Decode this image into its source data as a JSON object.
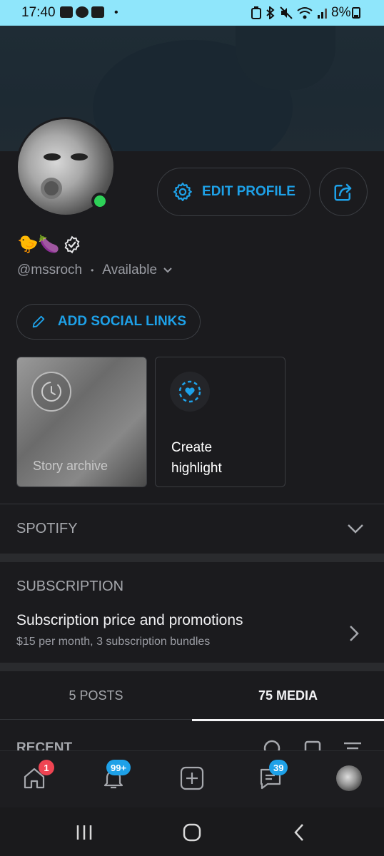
{
  "status_bar": {
    "time": "17:40",
    "battery": "8%",
    "background_color": "#8fe6fb"
  },
  "profile": {
    "emojis": "🐤🍆",
    "verified_icon": "verified-badge-icon",
    "handle": "@mssroch",
    "separator": "•",
    "availability": "Available",
    "edit_profile_label": "EDIT PROFILE",
    "add_social_links_label": "ADD SOCIAL LINKS",
    "online_color": "#2ed158"
  },
  "highlights": {
    "story_archive_label": "Story archive",
    "create_highlight_line1": "Create",
    "create_highlight_line2": "highlight"
  },
  "spotify": {
    "title": "SPOTIFY"
  },
  "subscription": {
    "section_title": "SUBSCRIPTION",
    "row_title": "Subscription price and promotions",
    "row_subtitle": "$15 per month, 3 subscription bundles"
  },
  "tabs": [
    {
      "label": "5 POSTS",
      "active": false
    },
    {
      "label": "75 MEDIA",
      "active": true
    }
  ],
  "recent_label": "RECENT",
  "bottom_nav": {
    "notifications_badge": "1",
    "bell_badge": "99+",
    "messages_badge": "39"
  },
  "accent_color": "#1ea1e8"
}
